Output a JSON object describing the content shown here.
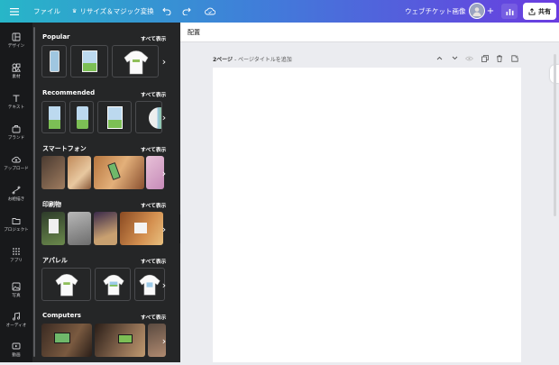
{
  "topbar": {
    "menu_icon": "hamburger-icon",
    "file_label": "ファイル",
    "resize_label": "リサイズ＆マジック変換",
    "resize_icon": "crown-icon",
    "doc_title": "ウェブチケット画像",
    "share_label": "共有",
    "colors": {
      "gradient_start": "#27b6c8",
      "gradient_mid": "#3f7fd9",
      "gradient_end": "#6a3ce0"
    }
  },
  "rail": {
    "items": [
      {
        "label": "デザイン",
        "icon": "layout-icon"
      },
      {
        "label": "素材",
        "icon": "shapes-icon"
      },
      {
        "label": "テキスト",
        "icon": "text-icon"
      },
      {
        "label": "ブランド",
        "icon": "brand-icon"
      },
      {
        "label": "アップロード",
        "icon": "cloud-upload-icon"
      },
      {
        "label": "お絵描き",
        "icon": "draw-icon"
      },
      {
        "label": "プロジェクト",
        "icon": "folder-icon"
      },
      {
        "label": "アプリ",
        "icon": "apps-icon"
      },
      {
        "label": "写真",
        "icon": "photo-icon"
      },
      {
        "label": "オーディオ",
        "icon": "music-icon"
      },
      {
        "label": "動画",
        "icon": "video-icon"
      }
    ]
  },
  "panel": {
    "see_all": "すべて表示",
    "sections": [
      {
        "title": "Popular"
      },
      {
        "title": "Recommended"
      },
      {
        "title": "スマートフォン"
      },
      {
        "title": "印刷物"
      },
      {
        "title": "アパレル"
      },
      {
        "title": "Computers"
      }
    ]
  },
  "editor": {
    "toolbar_label": "配置",
    "page_label_prefix": "2ページ",
    "page_label_suffix": " - ページタイトルを追加"
  }
}
